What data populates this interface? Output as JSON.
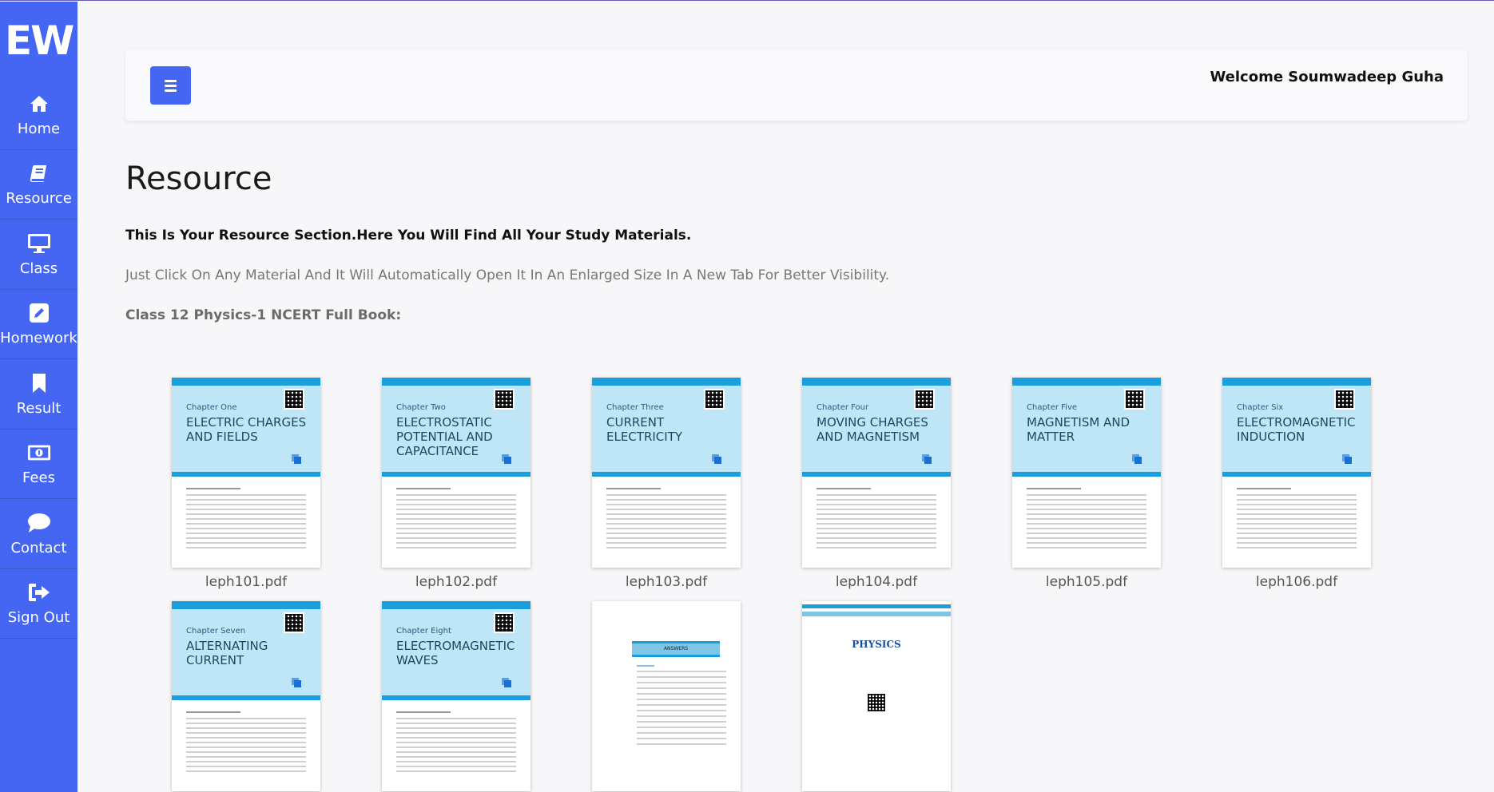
{
  "app": {
    "logo_text": "EW"
  },
  "sidebar": {
    "items": [
      {
        "label": "Home",
        "icon": "home-icon"
      },
      {
        "label": "Resource",
        "icon": "book-icon"
      },
      {
        "label": "Class",
        "icon": "monitor-icon"
      },
      {
        "label": "Homework",
        "icon": "edit-icon"
      },
      {
        "label": "Result",
        "icon": "bookmark-icon"
      },
      {
        "label": "Fees",
        "icon": "money-icon"
      },
      {
        "label": "Contact",
        "icon": "chat-bubble-icon"
      },
      {
        "label": "Sign Out",
        "icon": "sign-out-icon"
      }
    ]
  },
  "header": {
    "welcome": "Welcome Soumwadeep Guha"
  },
  "main": {
    "title": "Resource",
    "intro": "This Is Your Resource Section.Here You Will Find All Your Study Materials.",
    "hint": "Just Click On Any Material And It Will Automatically Open It In An Enlarged Size In A New Tab For Better Visibility.",
    "section_label": "Class 12 Physics-1 NCERT Full Book:"
  },
  "documents": [
    {
      "chapter": "Chapter One",
      "title": "Electric Charges and Fields",
      "file": "leph101.pdf"
    },
    {
      "chapter": "Chapter Two",
      "title": "Electrostatic Potential and Capacitance",
      "file": "leph102.pdf"
    },
    {
      "chapter": "Chapter Three",
      "title": "Current Electricity",
      "file": "leph103.pdf"
    },
    {
      "chapter": "Chapter Four",
      "title": "Moving Charges and Magnetism",
      "file": "leph104.pdf"
    },
    {
      "chapter": "Chapter Five",
      "title": "Magnetism and Matter",
      "file": "leph105.pdf"
    },
    {
      "chapter": "Chapter Six",
      "title": "Electromagnetic Induction",
      "file": "leph106.pdf"
    },
    {
      "chapter": "Chapter Seven",
      "title": "Alternating Current",
      "file": ""
    },
    {
      "chapter": "Chapter Eight",
      "title": "Electromagnetic Waves",
      "file": ""
    }
  ],
  "extra_docs": {
    "answers_heading": "ANSWERS",
    "physics_title": "PHYSICS"
  },
  "colors": {
    "accent": "#4466f2",
    "cover_blue": "#1a9fdc",
    "cover_light": "#bfe6f7"
  }
}
